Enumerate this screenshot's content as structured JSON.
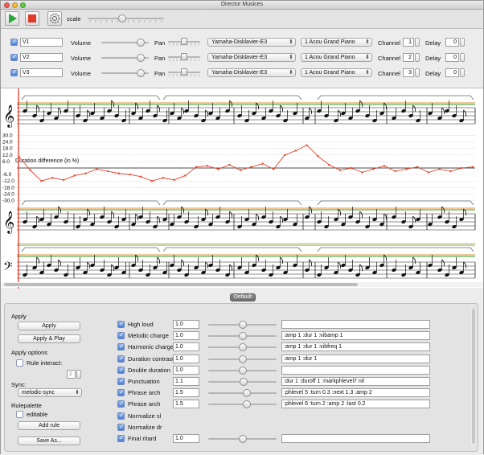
{
  "window": {
    "title": "Director Musices"
  },
  "toolbar": {
    "scale_label": "scale",
    "scale_value": 0.45
  },
  "voices": [
    {
      "name": "V1",
      "volume_label": "Volume",
      "pan_label": "Pan",
      "synth": "Yamaha-Disklavier-E3",
      "program": "1 Acou Grand Piano",
      "channel_label": "Channel",
      "channel": "1",
      "delay_label": "Delay",
      "delay": "0",
      "volume_value": 0.9
    },
    {
      "name": "V2",
      "volume_label": "Volume",
      "pan_label": "Pan",
      "synth": "Yamaha-Disklavier-E3",
      "program": "1 Acou Grand Piano",
      "channel_label": "Channel",
      "channel": "2",
      "delay_label": "Delay",
      "delay": "0",
      "volume_value": 0.9
    },
    {
      "name": "V3",
      "volume_label": "Volume",
      "pan_label": "Pan",
      "synth": "Yamaha-Disklavier-E3",
      "program": "1 Acou Grand Piano",
      "channel_label": "Channel",
      "channel": "3",
      "delay_label": "Delay",
      "delay": "0",
      "volume_value": 0.9
    }
  ],
  "graph": {
    "title": "Duration difference (in %)",
    "y_ticks": [
      "30.0",
      "24.0",
      "18.0",
      "12.0",
      "6.0",
      "-6.0",
      "-12.0",
      "-18.0",
      "-24.0",
      "-30.0"
    ],
    "ylim": [
      -30,
      30
    ],
    "values": [
      10,
      -2,
      -12,
      -9,
      -11,
      -7,
      -5,
      -1,
      -3,
      -5,
      -6,
      -8,
      -12,
      -9,
      -11,
      -7,
      1,
      2,
      -1,
      3,
      -2,
      1,
      4,
      -1,
      12,
      16,
      21,
      11,
      3,
      -2,
      0,
      -4,
      -1,
      2,
      -3,
      -1,
      1,
      -4,
      -1,
      -3,
      0,
      1
    ]
  },
  "bottom_tab": "Default",
  "apply_section": {
    "apply_label": "Apply",
    "apply_button": "Apply",
    "apply_play_button": "Apply & Play",
    "options_label": "Apply options",
    "rule_interact_label": "Rule interact:",
    "rule_interact_value": "2",
    "sync_label": "Sync:",
    "sync_value": "melodic-sync",
    "palette_label": "Rulepalette",
    "editable_label": "editable",
    "add_rule_button": "Add rule",
    "save_as_button": "Save As..."
  },
  "rules": [
    {
      "name": "High loud",
      "value": "1.0",
      "params": "",
      "slider": 0.5
    },
    {
      "name": "Melodic charge",
      "value": "1.0",
      "params": ":amp 1 :dur 1 :vibamp 1",
      "slider": 0.5
    },
    {
      "name": "Harmonic charge",
      "value": "1.0",
      "params": ":amp 1 :dur 1 :vibfreq 1",
      "slider": 0.5
    },
    {
      "name": "Duration contrast",
      "value": "1.0",
      "params": ":amp 1 :dur 1",
      "slider": 0.5
    },
    {
      "name": "Double duration",
      "value": "1.0",
      "params": "",
      "slider": 0.5
    },
    {
      "name": "Punctuation",
      "value": "1.1",
      "params": ":dur 1 :duroff 1 :markphlevel7 nil",
      "slider": 0.52
    },
    {
      "name": "Phrase arch",
      "value": "1.5",
      "params": ":phlevel 5 :turn 0.3 :next 1.3 :amp 2",
      "slider": 0.57
    },
    {
      "name": "Phrase arch",
      "value": "1.5",
      "params": ":phlevel 6 :turn 2 :amp 2 :last 0.2",
      "slider": 0.57
    },
    {
      "name": "Normalize sl",
      "value": null,
      "params": null,
      "slider": null
    },
    {
      "name": "Normalize dr",
      "value": null,
      "params": null,
      "slider": null
    },
    {
      "name": "Final ritard",
      "value": "1.0",
      "params": "",
      "slider": 0.5
    }
  ]
}
